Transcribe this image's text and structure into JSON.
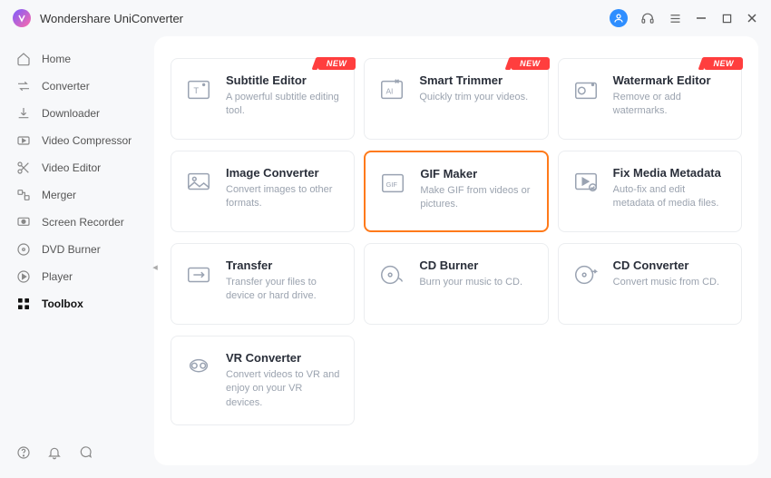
{
  "app_title": "Wondershare UniConverter",
  "badge_text": "NEW",
  "sidebar": [
    {
      "label": "Home"
    },
    {
      "label": "Converter"
    },
    {
      "label": "Downloader"
    },
    {
      "label": "Video Compressor"
    },
    {
      "label": "Video Editor"
    },
    {
      "label": "Merger"
    },
    {
      "label": "Screen Recorder"
    },
    {
      "label": "DVD Burner"
    },
    {
      "label": "Player"
    },
    {
      "label": "Toolbox"
    }
  ],
  "tools": [
    {
      "title": "Subtitle Editor",
      "desc": "A powerful subtitle editing tool.",
      "new": true
    },
    {
      "title": "Smart Trimmer",
      "desc": "Quickly trim your videos.",
      "new": true
    },
    {
      "title": "Watermark Editor",
      "desc": "Remove or add watermarks.",
      "new": true
    },
    {
      "title": "Image Converter",
      "desc": "Convert images to other formats.",
      "new": false
    },
    {
      "title": "GIF Maker",
      "desc": "Make GIF from videos or pictures.",
      "new": false
    },
    {
      "title": "Fix Media Metadata",
      "desc": "Auto-fix and edit metadata of media files.",
      "new": false
    },
    {
      "title": "Transfer",
      "desc": "Transfer your files to device or hard drive.",
      "new": false
    },
    {
      "title": "CD Burner",
      "desc": "Burn your music to CD.",
      "new": false
    },
    {
      "title": "CD Converter",
      "desc": "Convert music from CD.",
      "new": false
    },
    {
      "title": "VR Converter",
      "desc": "Convert videos to VR and enjoy on your VR devices.",
      "new": false
    }
  ]
}
